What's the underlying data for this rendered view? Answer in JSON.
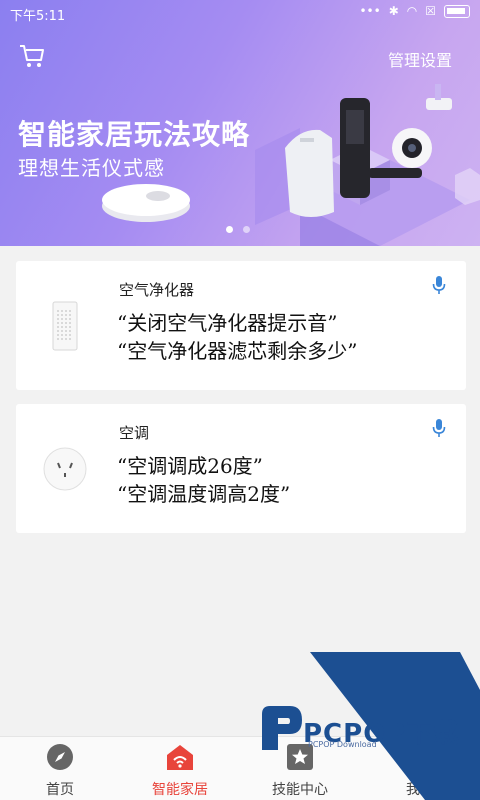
{
  "status_bar": {
    "time": "下午5:11"
  },
  "header": {
    "manage_label": "管理设置"
  },
  "banner": {
    "title": "智能家居玩法攻略",
    "subtitle": "理想生活仪式感",
    "slide_count": 2,
    "active_slide": 1
  },
  "devices": [
    {
      "name": "空气净化器",
      "line1": "“关闭空气净化器提示音”",
      "line2": "“空气净化器滤芯剩余多少”",
      "icon": "air-purifier-icon"
    },
    {
      "name": "空调",
      "line1": "“空调调成26度”",
      "line2": "“空调温度调高2度”",
      "icon": "ac-plug-icon"
    }
  ],
  "nav": {
    "items": [
      {
        "label": "首页",
        "icon": "compass-icon"
      },
      {
        "label": "智能家居",
        "icon": "smart-home-icon"
      },
      {
        "label": "技能中心",
        "icon": "star-icon"
      },
      {
        "label": "我的",
        "icon": "user-icon"
      }
    ],
    "active_index": 1
  },
  "watermark": {
    "text": "PCPOP下载",
    "small": "PCPOP Download"
  },
  "colors": {
    "accent": "#e8443b",
    "mic": "#3a86d8",
    "banner_start": "#8b7ff0",
    "banner_end": "#cdb2f2",
    "watermark": "#1c4f92"
  }
}
